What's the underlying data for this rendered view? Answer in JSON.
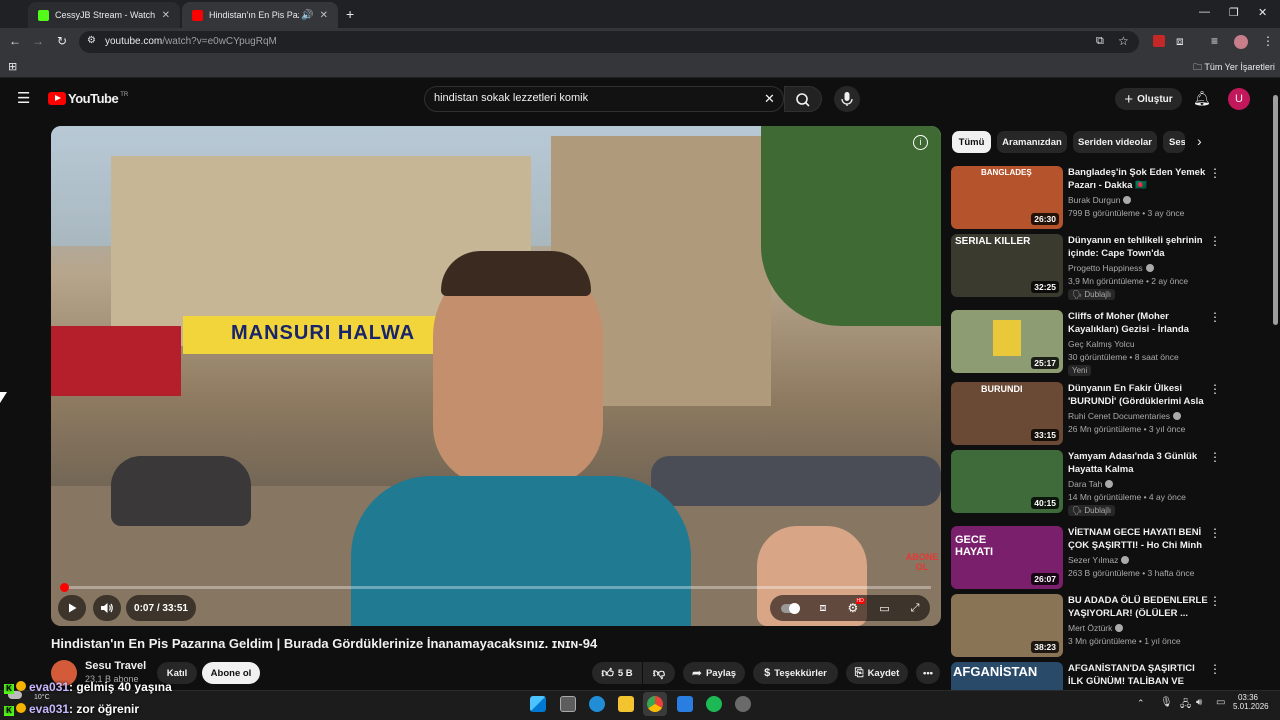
{
  "browser": {
    "tabs": [
      {
        "title": "CessyJB Stream - Watch Live on Kick",
        "favicon_color": "#53fc18",
        "active": false
      },
      {
        "title": "Hindistan'ın En Pis Pazarına Geldim",
        "favicon_color": "#ff0000",
        "active": true
      }
    ],
    "url_host": "youtube.com",
    "url_path": "/watch?v=e0wCYpugRqM",
    "bookmarks_all": "Tüm Yer İşaretleri"
  },
  "youtube": {
    "logo_text": "YouTube",
    "logo_badge": "TR",
    "search_query": "hindistan sokak lezzetleri komik",
    "create_label": "Oluştur",
    "avatar_letter": "U"
  },
  "player": {
    "time_current": "0:07",
    "time_total": "33:51",
    "time_display": "0:07 / 33:51",
    "progress_fraction": 0.0034,
    "overlay_watermark": "ABONE OL",
    "sign_text": "MANSURI HALWA"
  },
  "video": {
    "title": "Hindistan'ın En Pis Pazarına Geldim | Burada Gördüklerinize İnanamayacaksınız. ɪɴɪɴ-94",
    "channel": "Sesu Travel",
    "subscribers": "23,1 B abone",
    "join_label": "Katıl",
    "subscribe_label": "Abone ol",
    "likes": "5 B",
    "share_label": "Paylaş",
    "thanks_label": "Teşekkürler",
    "save_label": "Kaydet"
  },
  "chips": [
    "Tümü",
    "Aramanızdan",
    "Seriden videolar",
    "Sesu Travel"
  ],
  "recommendations": [
    {
      "title": "Bangladeş'in Şok Eden Yemek Pazarı - Dakka 🇧🇩",
      "channel": "Burak Durgun",
      "meta": "799 B görüntüleme • 3 ay önce",
      "duration": "26:30",
      "badge": "",
      "thumb_color": "#b5542c",
      "thumb_text": "BANGLADEŞ"
    },
    {
      "title": "Dünyanın en tehlikeli şehrinin içinde: Cape Town'da yaşamak...",
      "channel": "Progetto Happiness",
      "meta": "3,9 Mn görüntüleme • 2 ay önce",
      "duration": "32:25",
      "badge": "Dublajlı",
      "thumb_color": "#3a3a2f",
      "thumb_text": "SERIAL KILLER"
    },
    {
      "title": "Cliffs of Moher (Moher Kayalıkları) Gezisi - İrlanda",
      "channel": "Geç Kalmış Yolcu",
      "meta": "30 görüntüleme • 8 saat önce",
      "duration": "25:17",
      "badge": "Yeni",
      "thumb_color": "#8e9c73",
      "thumb_text": ""
    },
    {
      "title": "Dünyanın En Fakir Ülkesi 'BURUNDİ' (Gördüklerimi Asla ...",
      "channel": "Ruhi Cenet Documentaries",
      "meta": "26 Mn görüntüleme • 3 yıl önce",
      "duration": "33:15",
      "badge": "",
      "thumb_color": "#6b4a35",
      "thumb_text": "BURUNDI"
    },
    {
      "title": "Yamyam Adası'nda 3 Günlük Hayatta Kalma",
      "channel": "Dara Tah",
      "meta": "14 Mn görüntüleme • 4 ay önce",
      "duration": "40:15",
      "badge": "Dublajlı",
      "thumb_color": "#3f6b3a",
      "thumb_text": ""
    },
    {
      "title": "VİETNAM GECE HAYATI BENİ ÇOK ŞAŞIRTTI! - Ho Chi Minh",
      "channel": "Sezer Yılmaz",
      "meta": "263 B görüntüleme • 3 hafta önce",
      "duration": "26:07",
      "badge": "",
      "thumb_color": "#7a1f6b",
      "thumb_text": "GECE HAYATI"
    },
    {
      "title": "BU ADADA ÖLÜ BEDENLERLE YAŞIYORLAR! (ÖLÜLER ...",
      "channel": "Mert Öztürk",
      "meta": "3 Mn görüntüleme • 1 yıl önce",
      "duration": "38:23",
      "badge": "",
      "thumb_color": "#8a7456",
      "thumb_text": ""
    },
    {
      "title": "AFGANİSTAN'DA ŞAŞIRTICI İLK GÜNÜM! TALİBAN VE ŞERİAT ...",
      "channel": "",
      "meta": "",
      "duration": "",
      "badge": "",
      "thumb_color": "#2a4a6a",
      "thumb_text": "AFGANİSTAN"
    }
  ],
  "chat": [
    {
      "user": "eva031",
      "message": ": gelmiş 40 yaşına"
    },
    {
      "user": "eva031",
      "message": ": zor öğrenir"
    }
  ],
  "taskbar": {
    "weather": "10°C",
    "time": "03:36",
    "date": "5.01.2026"
  }
}
